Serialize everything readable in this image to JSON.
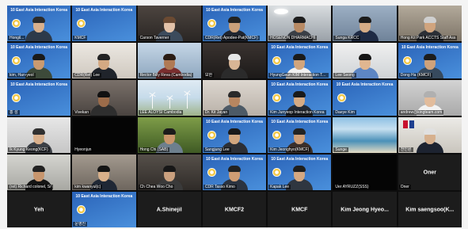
{
  "gallery": {
    "slide_title": "10 East Asia Interaction Korea",
    "slide_bg": [
      "#2a63b8",
      "#4a90dc"
    ],
    "rows": [
      [
        {
          "kind": "slide",
          "label": "Hongil...",
          "person": {
            "skin": "#d9b08c",
            "hair": "#2b2b2b",
            "shirt": "#2d3a4a"
          }
        },
        {
          "kind": "slide",
          "label": "KMCF"
        },
        {
          "kind": "video",
          "label": "Carson Taverner",
          "bg": [
            "#4d4540",
            "#2a2624"
          ],
          "person": {
            "skin": "#e3c2a8",
            "hair": "#6b4a32",
            "shirt": "#3c4b5c"
          }
        },
        {
          "kind": "slide",
          "label": "CDR(Ret) Apodee-Pat(KMCF)",
          "person": {
            "skin": "#caa07a",
            "hair": "#222222",
            "shirt": "#1f2530"
          }
        },
        {
          "kind": "video",
          "label": "HOSENON DHARMACHI",
          "bg": [
            "#d8dcdf",
            "#9aa1a8"
          ],
          "decor": "ceiling-light",
          "person": {
            "skin": "#b88a64",
            "hair": "#1e1e1e",
            "shirt": "#3a3f46"
          }
        },
        {
          "kind": "video",
          "label": "Sunga KRCC",
          "bg": [
            "#9db0c4",
            "#6f8399"
          ],
          "person": {
            "skin": "#d5ac86",
            "hair": "#1c1c1c",
            "shirt": "#1e2a44"
          }
        },
        {
          "kind": "video",
          "label": "Hong Kil Park ACCTS Staff Ass",
          "bg": [
            "#b3aa9b",
            "#7d7467"
          ],
          "person": {
            "skin": "#d0a47e",
            "hair": "#cfcfcf",
            "shirt": "#2b2f36"
          }
        }
      ],
      [
        {
          "kind": "slide",
          "label": "kim, Han-yeol",
          "person": {
            "skin": "#c99a70",
            "hair": "#1a1a1a",
            "shirt": "#3d4a3a"
          }
        },
        {
          "kind": "video",
          "label": "CDR(Ret) Lee",
          "bg": [
            "#ece8e2",
            "#cfc8bf"
          ],
          "person": {
            "skin": "#d4a983",
            "hair": "#222222",
            "shirt": "#20242b"
          }
        },
        {
          "kind": "video",
          "label": "Rector Billy Reva (Cambodia)",
          "bg": [
            "#c5d6e6",
            "#8ea7bf"
          ],
          "person": {
            "skin": "#b07a55",
            "hair": "#2a1c14",
            "shirt": "#7a2e2e"
          }
        },
        {
          "kind": "video",
          "label": "보한",
          "bg": [
            "#3a3330",
            "#1c1a19"
          ],
          "person": {
            "skin": "#d8b595",
            "hair": "#e6e6e6",
            "shirt": "#2b2b2b"
          }
        },
        {
          "kind": "slide",
          "label": "HyungGeun KIM Interaction Team",
          "person": {
            "skin": "#d1a57c",
            "hair": "#1b1b1b",
            "shirt": "#f0f0f0"
          }
        },
        {
          "kind": "video",
          "label": "Lee Seong",
          "bg": [
            "#f0f0f0",
            "#cfd3d6"
          ],
          "person": {
            "skin": "#e0b690",
            "hair": "#151515",
            "shirt": "#5d86c4"
          }
        },
        {
          "kind": "slide",
          "label": "Dong Ha (KMCF)",
          "person": {
            "skin": "#cfa27b",
            "hair": "#1d1d1d",
            "shirt": "#374a5e"
          }
        }
      ],
      [
        {
          "kind": "slide",
          "label": "홍 성"
        },
        {
          "kind": "video",
          "label": "Vivekan",
          "bg": [
            "#7a716a",
            "#4a4440"
          ],
          "person": {
            "skin": "#9c6c4a",
            "hair": "#111111",
            "shirt": "#2e2e2e"
          }
        },
        {
          "kind": "video",
          "label": "LEE ALOYSI Cambodia",
          "bg": [
            "#dfeaf3",
            "#c6dbea",
            "#9fb38a"
          ],
          "decor": "wind-turbines"
        },
        {
          "kind": "video",
          "label": "Dr. Kit Jayan",
          "bg": [
            "#ddd7d0",
            "#b9b1a8"
          ],
          "person": {
            "skin": "#b88660",
            "hair": "#2a2a2a",
            "shirt": "#4d5a66"
          }
        },
        {
          "kind": "slide",
          "label": "Kim Junyeop Interaction Korea",
          "person": {
            "skin": "#d6ab84",
            "hair": "#1a1a1a",
            "shirt": "#232a35"
          }
        },
        {
          "kind": "slide",
          "label": "Daeye Kim"
        },
        {
          "kind": "video",
          "label": "andrew@kingteam.com",
          "bg": [
            "#d3d3d3",
            "#a9a9a9"
          ],
          "person": {
            "skin": "#e2bc9c",
            "hair": "#b0b0b0",
            "shirt": "#f2f2f2"
          }
        }
      ],
      [
        {
          "kind": "video",
          "label": "Ik Kyung Keong(KCF)",
          "bg": [
            "#e7e7e7",
            "#c6c6c6"
          ],
          "person": {
            "skin": "#d9b08c",
            "hair": "#303030",
            "shirt": "#3b3f45"
          }
        },
        {
          "kind": "blank",
          "label": "Hyeonjun"
        },
        {
          "kind": "video",
          "label": "Hong Chi (SAB)",
          "bg": [
            "#7e9d48",
            "#3f5a24"
          ],
          "person": {
            "skin": "#c9956b",
            "hair": "#1b1b1b",
            "shirt": "#6d7f8d"
          }
        },
        {
          "kind": "slide",
          "label": "Sangjung Lee",
          "person": {
            "skin": "#d2a67e",
            "hair": "#1a1a1a",
            "shirt": "#2c2f35"
          }
        },
        {
          "kind": "slide",
          "label": "Kim Jeonghyo(KMCF)",
          "person": {
            "skin": "#cf9f77",
            "hair": "#232323",
            "shirt": "#3a2f2a"
          }
        },
        {
          "kind": "video",
          "label": "Sunge",
          "bg": [
            "#8cbfe3",
            "#c7e0f0",
            "#4a90b8",
            "#e5dcc4"
          ]
        },
        {
          "kind": "video",
          "label": "천인원",
          "bg": [
            "#ecebe7",
            "#c9c5bd"
          ],
          "decor": "flags",
          "person": {
            "skin": "#d6b08e",
            "hair": "#e0e0e0",
            "shirt": "#1d2330"
          }
        }
      ],
      [
        {
          "kind": "video",
          "label": "(ret) Richard colonel, Sr",
          "bg": [
            "#d5d5d0",
            "#a8a8a2"
          ],
          "person": {
            "skin": "#c7966e",
            "hair": "#222222",
            "shirt": "#141414"
          }
        },
        {
          "kind": "video",
          "label": "kim kwanyul(c)",
          "bg": [
            "#a39a8f",
            "#6e665e"
          ],
          "person": {
            "skin": "#d8b08a",
            "hair": "#151515",
            "shirt": "#1f2735"
          }
        },
        {
          "kind": "video",
          "label": "Ch Chea Woo Cho",
          "bg": [
            "#56504a",
            "#2f2b28"
          ],
          "person": {
            "skin": "#caa07e",
            "hair": "#171717",
            "shirt": "#3a3a3a"
          }
        },
        {
          "kind": "slide",
          "label": "CDR Tasso Kimo",
          "person": {
            "skin": "#cf9d74",
            "hair": "#222222",
            "shirt": "#2b3340"
          }
        },
        {
          "kind": "slide",
          "label": "Kapak Lee",
          "person": {
            "skin": "#d4a882",
            "hair": "#1e1e1e",
            "shirt": "#2f3640"
          }
        },
        {
          "kind": "blank",
          "label": "Uer AYRUZZ(SSS)"
        },
        {
          "kind": "name",
          "display_name": "Oner",
          "label": "Oner"
        }
      ],
      [
        {
          "kind": "name",
          "display_name": "Yeh"
        },
        {
          "kind": "slide",
          "label": "운영진"
        },
        {
          "kind": "name",
          "display_name": "A.Shinejil"
        },
        {
          "kind": "name",
          "display_name": "KMCF2"
        },
        {
          "kind": "name",
          "display_name": "KMCF"
        },
        {
          "kind": "name",
          "display_name": "Kim Jeong Hyeo..."
        },
        {
          "kind": "name",
          "display_name": "Kim saengsoo(K..."
        }
      ]
    ]
  }
}
